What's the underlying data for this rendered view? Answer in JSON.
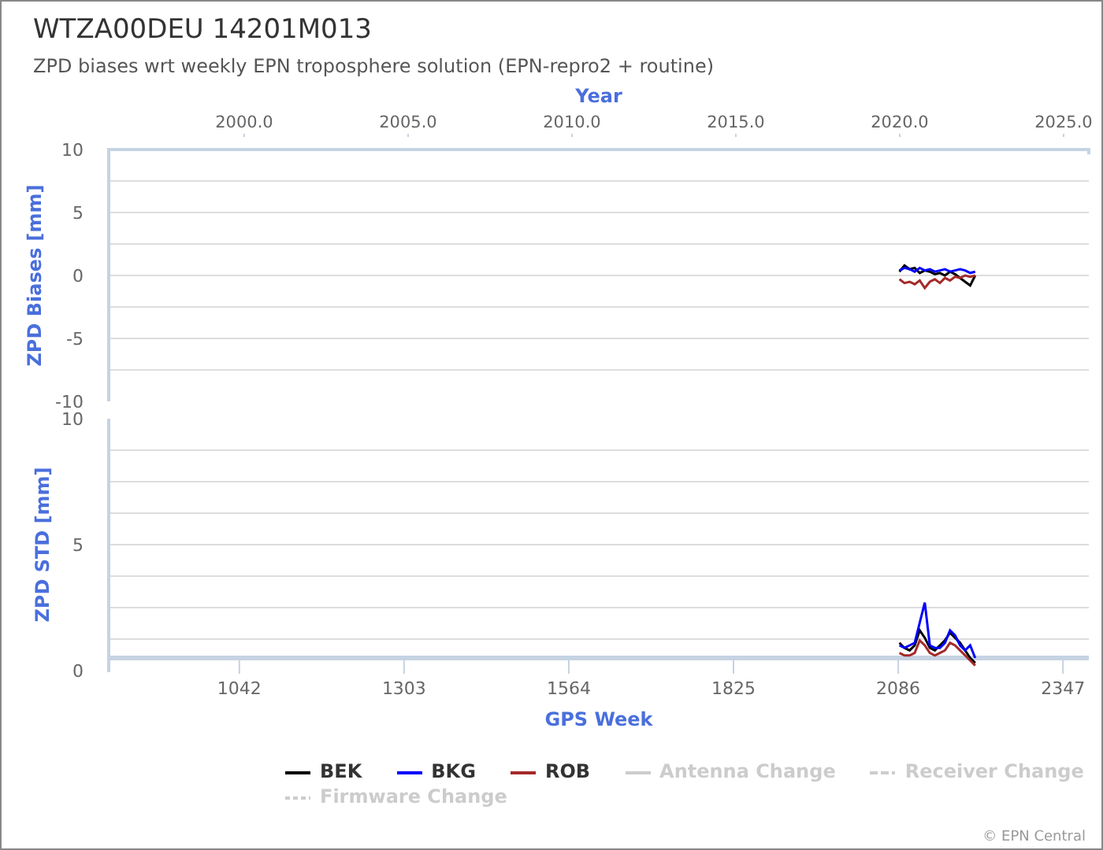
{
  "title": "WTZA00DEU 14201M013",
  "subtitle": "ZPD biases wrt weekly EPN troposphere solution (EPN-repro2 + routine)",
  "year_axis": {
    "title": "Year",
    "ticks": [
      "2000.0",
      "2005.0",
      "2010.0",
      "2015.0",
      "2020.0",
      "2025.0"
    ]
  },
  "charts": [
    {
      "chart_data": {
        "type": "line",
        "grid": true,
        "ylabel": "ZPD Biases [mm]",
        "xlim": [
          835,
          2388
        ],
        "ylim": [
          -10,
          10
        ],
        "yticks": [
          -10,
          -5,
          0,
          5,
          10
        ],
        "x": [
          2088,
          2096,
          2104,
          2112,
          2120,
          2128,
          2136,
          2144,
          2152,
          2160,
          2168,
          2176,
          2184,
          2192,
          2200,
          2208
        ],
        "series": [
          {
            "color": "#000000",
            "values": [
              0.3,
              0.8,
              0.5,
              0.6,
              0.2,
              0.4,
              0.3,
              0.1,
              0.2,
              0.0,
              0.3,
              0.1,
              -0.2,
              -0.5,
              -0.8,
              0.0
            ]
          },
          {
            "color": "#0000ff",
            "values": [
              0.4,
              0.6,
              0.5,
              0.3,
              0.6,
              0.4,
              0.5,
              0.3,
              0.4,
              0.5,
              0.3,
              0.4,
              0.5,
              0.4,
              0.2,
              0.3
            ]
          },
          {
            "color": "#a52a2a",
            "values": [
              -0.3,
              -0.6,
              -0.5,
              -0.7,
              -0.4,
              -1.0,
              -0.5,
              -0.3,
              -0.6,
              -0.2,
              -0.4,
              -0.1,
              -0.2,
              0.0,
              -0.1,
              0.0
            ]
          }
        ]
      }
    },
    {
      "chart_data": {
        "type": "line",
        "grid": true,
        "xlabel": "GPS Week",
        "ylabel": "ZPD STD [mm]",
        "xlim": [
          835,
          2388
        ],
        "ylim": [
          0,
          10
        ],
        "xticks": [
          1042,
          1303,
          1564,
          1825,
          2086,
          2347
        ],
        "yticks": [
          0,
          5,
          10
        ],
        "x": [
          2088,
          2096,
          2104,
          2112,
          2120,
          2128,
          2136,
          2144,
          2152,
          2160,
          2168,
          2176,
          2184,
          2192,
          2200,
          2208
        ],
        "series": [
          {
            "color": "#000000",
            "values": [
              1.1,
              0.9,
              0.8,
              1.0,
              1.6,
              1.3,
              0.9,
              0.8,
              1.0,
              1.2,
              1.5,
              1.3,
              1.1,
              0.8,
              0.5,
              0.3
            ]
          },
          {
            "color": "#0000ff",
            "values": [
              1.0,
              0.9,
              1.0,
              1.1,
              1.9,
              2.7,
              1.0,
              0.9,
              0.9,
              1.1,
              1.6,
              1.4,
              1.0,
              0.8,
              1.0,
              0.5
            ]
          },
          {
            "color": "#a52a2a",
            "values": [
              0.7,
              0.6,
              0.6,
              0.7,
              1.2,
              1.0,
              0.7,
              0.6,
              0.7,
              0.8,
              1.1,
              1.0,
              0.8,
              0.6,
              0.4,
              0.2
            ]
          }
        ]
      }
    }
  ],
  "legend": [
    {
      "label": "BEK",
      "color": "#000000",
      "kind": "solid",
      "visible": true
    },
    {
      "label": "BKG",
      "color": "#0000ff",
      "kind": "solid",
      "visible": true
    },
    {
      "label": "ROB",
      "color": "#a52a2a",
      "kind": "solid",
      "visible": true
    },
    {
      "label": "Antenna Change",
      "kind": "solid",
      "visible": false
    },
    {
      "label": "Receiver Change",
      "kind": "dashed",
      "visible": false
    },
    {
      "label": "Firmware Change",
      "kind": "dotted",
      "visible": false
    }
  ],
  "credit": "© EPN Central"
}
